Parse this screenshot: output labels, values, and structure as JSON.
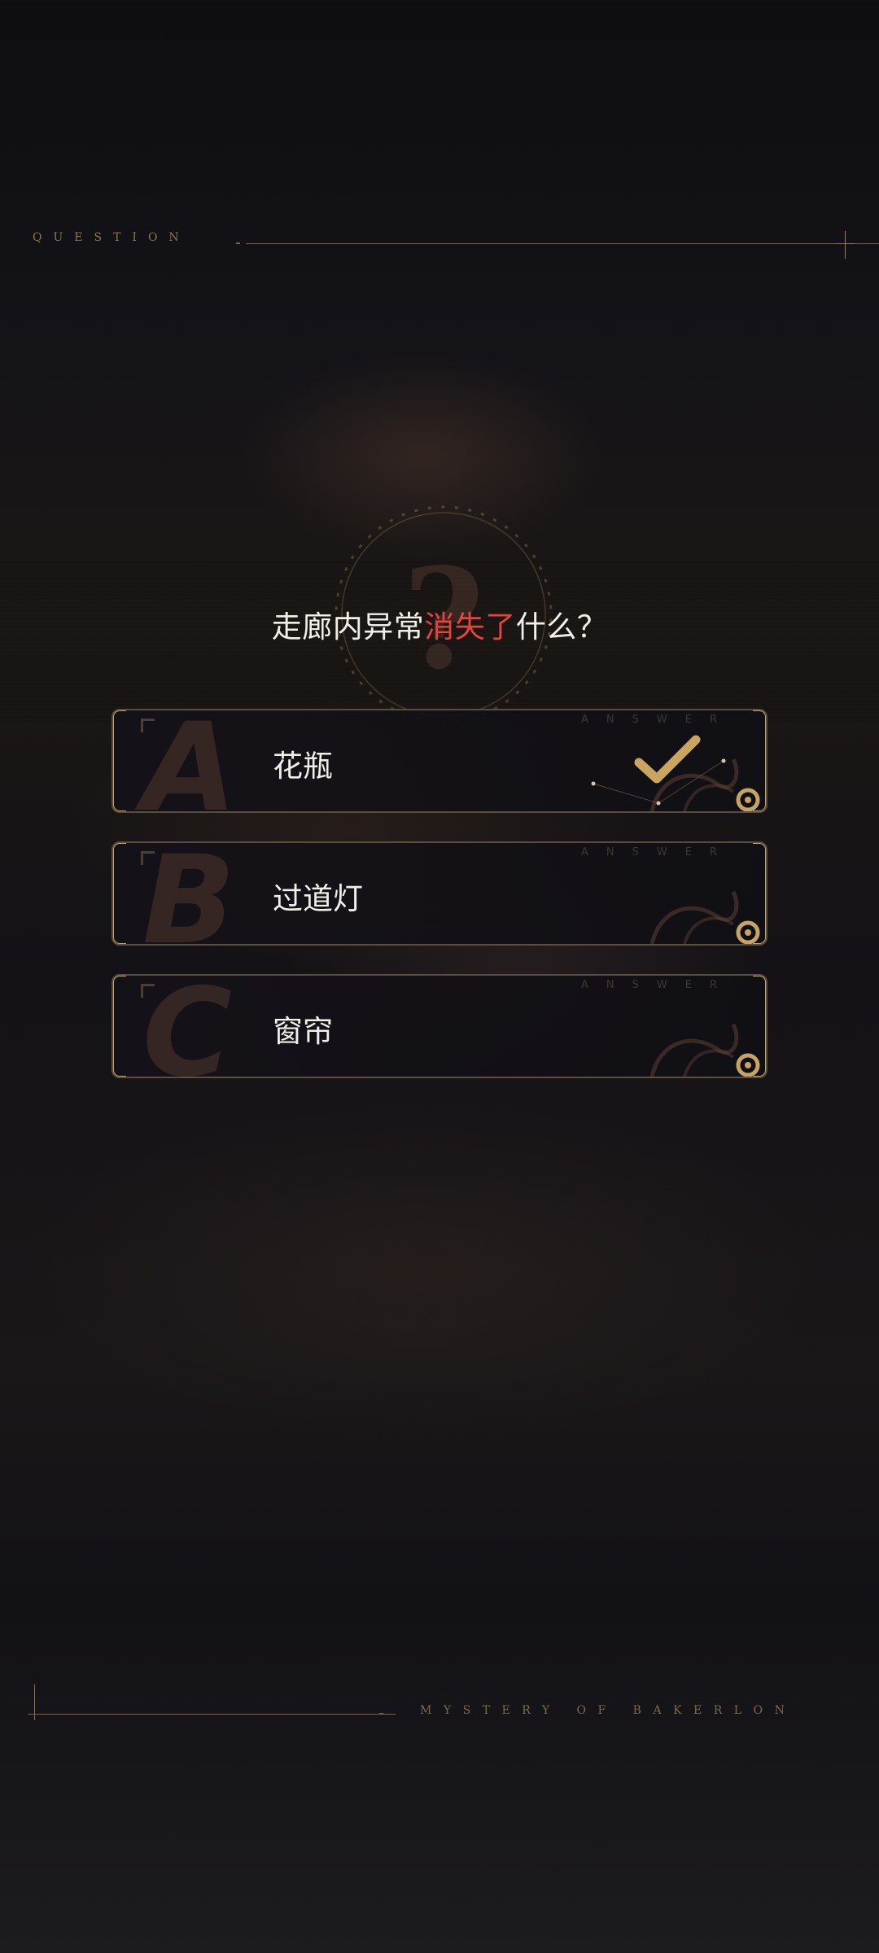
{
  "header": {
    "label": "QUESTION"
  },
  "emblem": {
    "icon": "question-mark-emblem-icon"
  },
  "question": {
    "prefix": "走廊内异常",
    "highlight": "消失了",
    "suffix": "什么？",
    "highlight_color": "#e5443a"
  },
  "options": [
    {
      "letter": "A",
      "text": "花瓶",
      "tag": "ANSWER",
      "selected": true
    },
    {
      "letter": "B",
      "text": "过道灯",
      "tag": "ANSWER",
      "selected": false
    },
    {
      "letter": "C",
      "text": "窗帘",
      "tag": "ANSWER",
      "selected": false
    }
  ],
  "footer": {
    "label": "MYSTERY OF BAKERLON"
  },
  "colors": {
    "gold": "#c7a466",
    "text": "#f2eee8"
  }
}
